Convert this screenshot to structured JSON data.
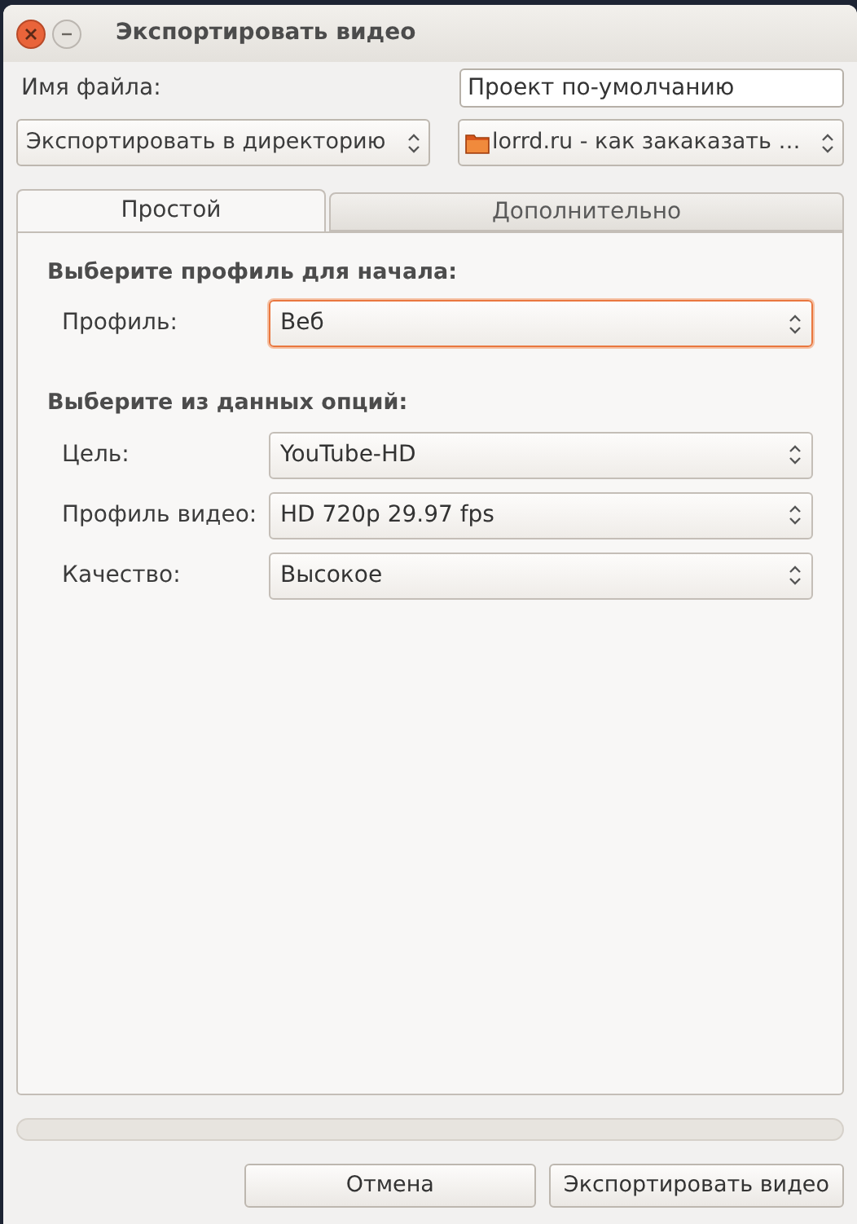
{
  "window": {
    "title": "Экспортировать видео"
  },
  "file_name": {
    "label": "Имя файла:",
    "value": "Проект по-умолчанию"
  },
  "destination": {
    "mode": "Экспортировать в директорию",
    "folder": "lorrd.ru - как закаказать …"
  },
  "tabs": [
    {
      "label": "Простой",
      "selected": true
    },
    {
      "label": "Дополнительно",
      "selected": false
    }
  ],
  "sections": [
    {
      "heading": "Выберите профиль для начала:",
      "fields": [
        {
          "label": "Профиль:",
          "value": "Веб",
          "focused": true
        }
      ]
    },
    {
      "heading": "Выберите из данных опций:",
      "fields": [
        {
          "label": "Цель:",
          "value": "YouTube-HD",
          "focused": false
        },
        {
          "label": "Профиль видео:",
          "value": "HD 720p 29.97 fps",
          "focused": false
        },
        {
          "label": "Качество:",
          "value": "Высокое",
          "focused": false
        }
      ]
    }
  ],
  "buttons": [
    "Отмена",
    "Экспортировать видео"
  ]
}
